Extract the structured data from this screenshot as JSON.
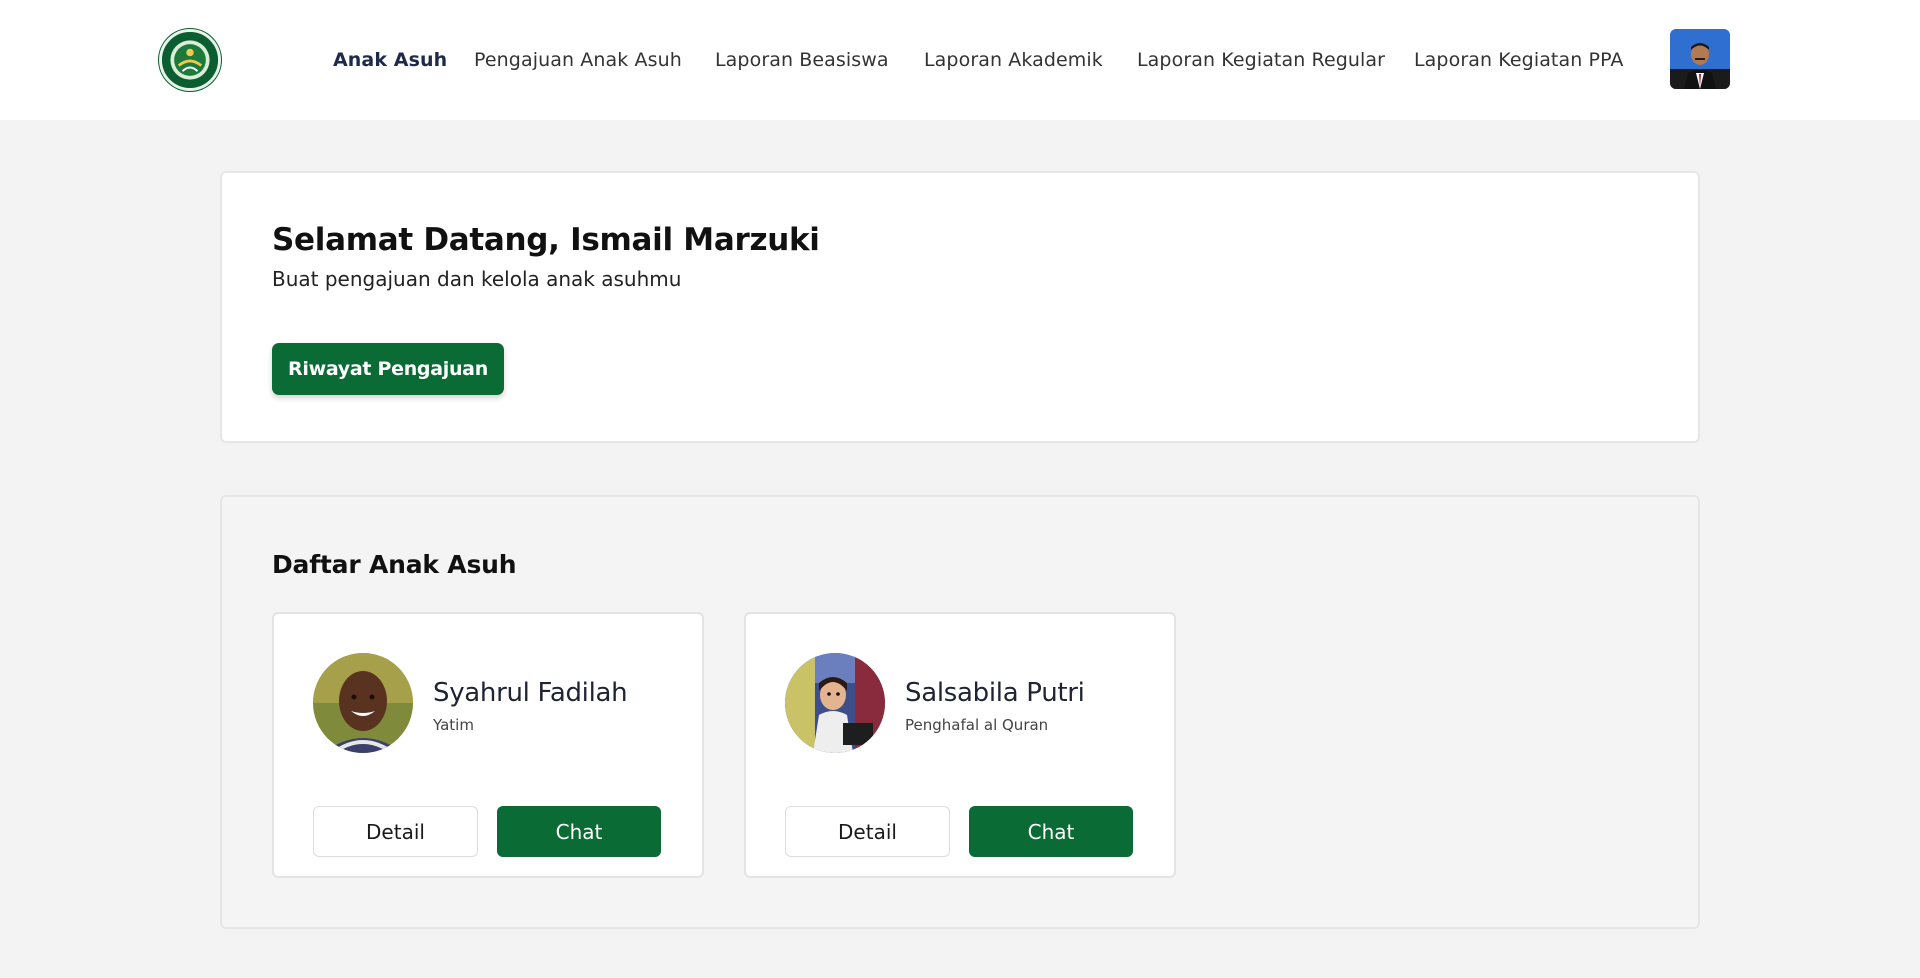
{
  "colors": {
    "brand_green": "#0b6b35",
    "page_background": "#f3f3f3",
    "card_background": "#ffffff"
  },
  "header": {
    "logo_icon": "peduli-yatim-logo",
    "nav": [
      {
        "label": "Anak Asuh",
        "active": true
      },
      {
        "label": "Pengajuan Anak Asuh",
        "active": false
      },
      {
        "label": "Laporan Beasiswa",
        "active": false
      },
      {
        "label": "Laporan Akademik",
        "active": false
      },
      {
        "label": "Laporan Kegiatan Regular",
        "active": false
      },
      {
        "label": "Laporan Kegiatan PPA",
        "active": false
      }
    ],
    "avatar_icon": "user-profile-photo"
  },
  "welcome": {
    "title": "Selamat Datang, Ismail Marzuki",
    "subtitle": "Buat pengajuan dan kelola anak asuhmu",
    "history_button": "Riwayat Pengajuan"
  },
  "children": {
    "title": "Daftar Anak Asuh",
    "items": [
      {
        "name": "Syahrul Fadilah",
        "status": "Yatim",
        "detail_label": "Detail",
        "chat_label": "Chat"
      },
      {
        "name": "Salsabila Putri",
        "status": "Penghafal al Quran",
        "detail_label": "Detail",
        "chat_label": "Chat"
      }
    ]
  }
}
